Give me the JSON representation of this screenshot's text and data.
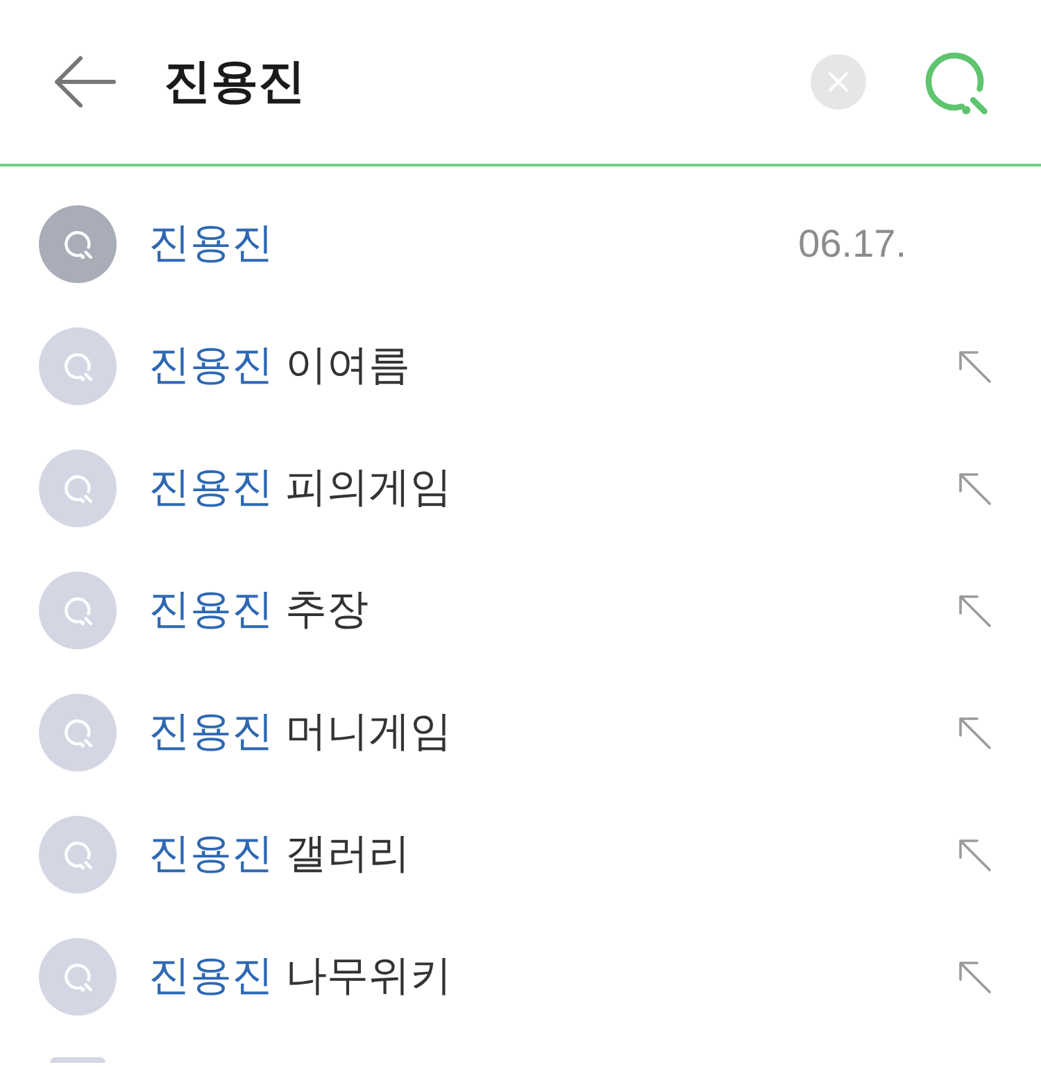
{
  "search_bar": {
    "query": "진용진"
  },
  "suggestions": [
    {
      "kind": "recent",
      "match": "진용진",
      "date": "06.17."
    },
    {
      "kind": "suggestion",
      "match": "진용진",
      "rest": "이여름"
    },
    {
      "kind": "suggestion",
      "match": "진용진",
      "rest": "피의게임"
    },
    {
      "kind": "suggestion",
      "match": "진용진",
      "rest": "추장"
    },
    {
      "kind": "suggestion",
      "match": "진용진",
      "rest": "머니게임"
    },
    {
      "kind": "suggestion",
      "match": "진용진",
      "rest": "갤러리"
    },
    {
      "kind": "suggestion",
      "match": "진용진",
      "rest": "나무위키"
    }
  ]
}
